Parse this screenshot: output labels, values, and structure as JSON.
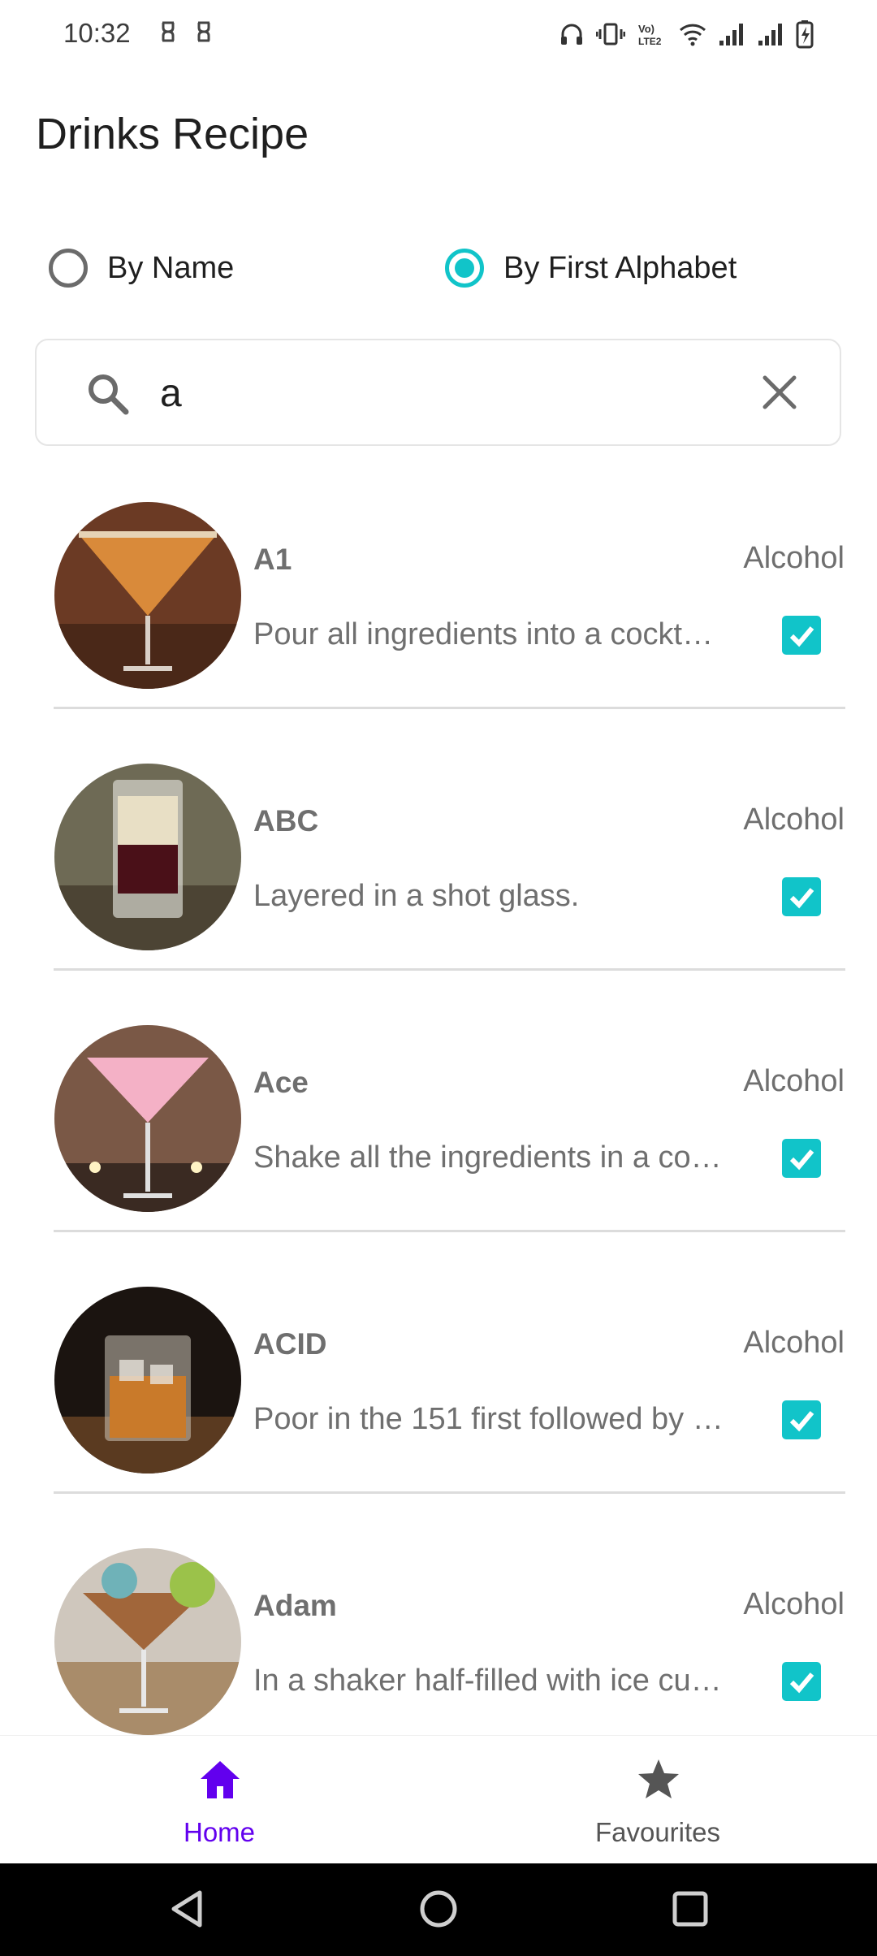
{
  "status": {
    "time": "10:32"
  },
  "header": {
    "title": "Drinks Recipe"
  },
  "search_mode": {
    "options": [
      {
        "label": "By Name",
        "selected": false
      },
      {
        "label": "By First Alphabet",
        "selected": true
      }
    ]
  },
  "search": {
    "value": "a"
  },
  "drinks": [
    {
      "name": "A1",
      "category": "Alcohol",
      "instructions": "Pour all ingredients into a cockt…",
      "checked": true,
      "thumb_colors": [
        "#6b3a24",
        "#d98a3a"
      ]
    },
    {
      "name": "ABC",
      "category": "Alcohol",
      "instructions": "Layered in a shot glass.",
      "checked": true,
      "thumb_colors": [
        "#6e6a55",
        "#e8dfc5"
      ]
    },
    {
      "name": "Ace",
      "category": "Alcohol",
      "instructions": "Shake all the ingredients in a co…",
      "checked": true,
      "thumb_colors": [
        "#7a5846",
        "#f4b1c6"
      ]
    },
    {
      "name": "ACID",
      "category": "Alcohol",
      "instructions": "Poor in the 151 first followed by …",
      "checked": true,
      "thumb_colors": [
        "#1b1410",
        "#c97a2a"
      ]
    },
    {
      "name": "Adam",
      "category": "Alcohol",
      "instructions": "In a shaker half-filled with ice cu…",
      "checked": true,
      "thumb_colors": [
        "#cfc7bd",
        "#a1663a"
      ]
    }
  ],
  "bottom_nav": {
    "home": "Home",
    "favourites": "Favourites"
  },
  "colors": {
    "accent": "#11c4c9",
    "primary": "#6200ee"
  }
}
